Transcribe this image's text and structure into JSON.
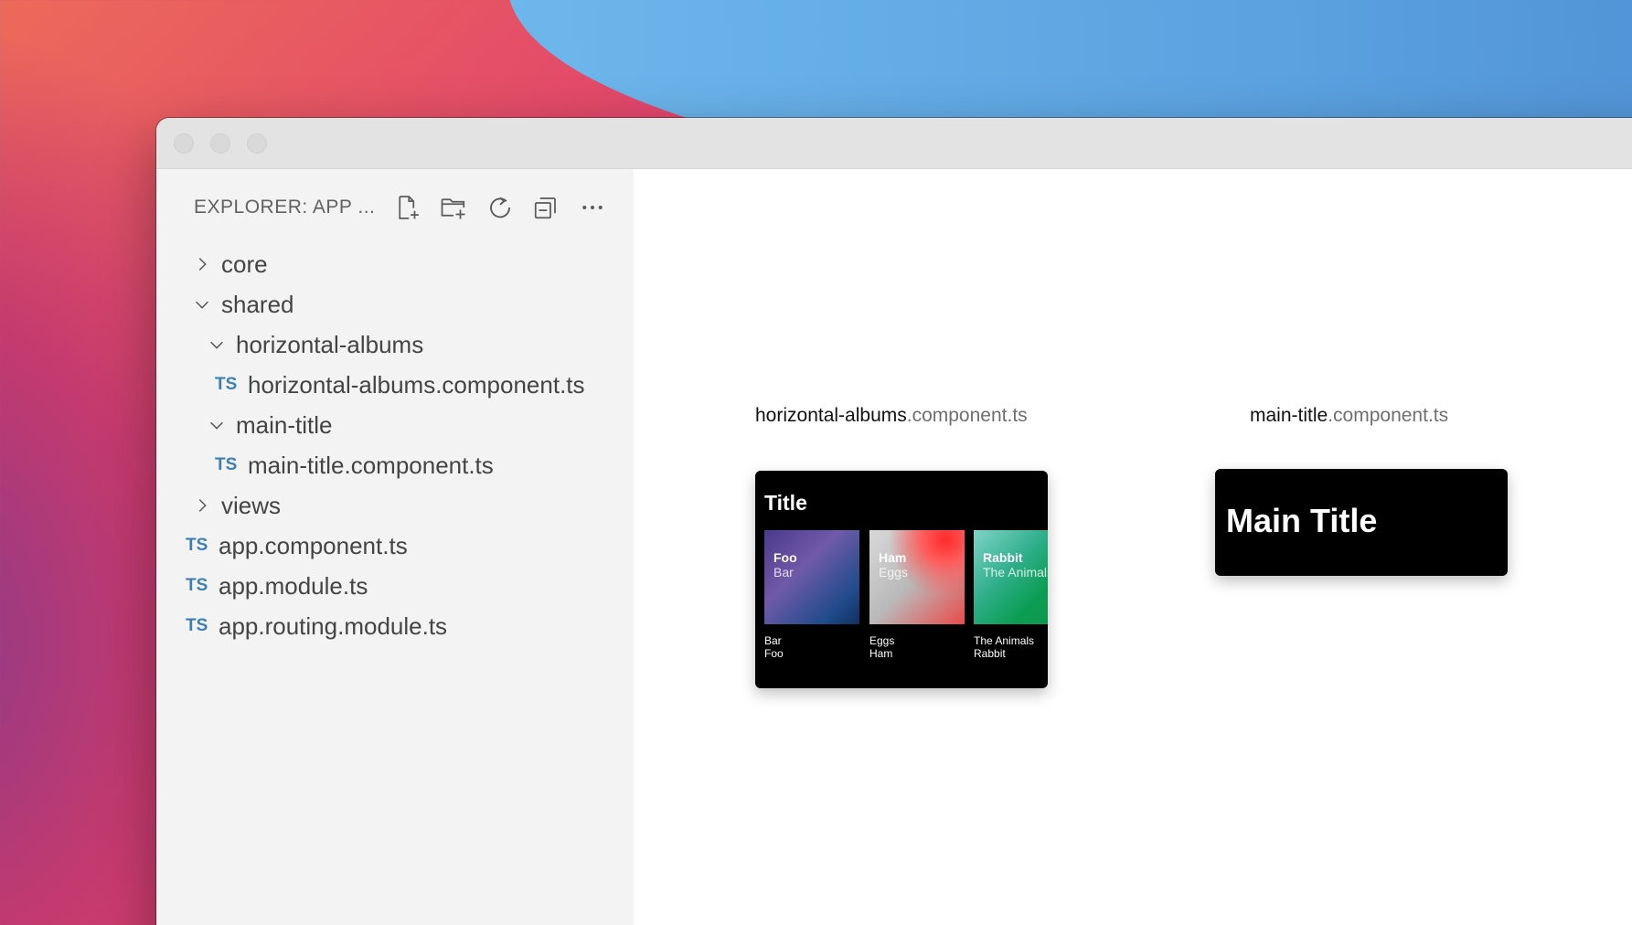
{
  "sidebar": {
    "title": "EXPLORER: APP ...",
    "toolbar": [
      "new-file-icon",
      "new-folder-icon",
      "refresh-icon",
      "collapse-all-icon",
      "more-icon"
    ],
    "tree": [
      {
        "label": "core",
        "kind": "folder",
        "expanded": false
      },
      {
        "label": "shared",
        "kind": "folder",
        "expanded": true
      },
      {
        "label": "horizontal-albums",
        "kind": "folder",
        "expanded": true
      },
      {
        "label": "horizontal-albums.component.ts",
        "kind": "ts-file",
        "badge": "TS"
      },
      {
        "label": "main-title",
        "kind": "folder",
        "expanded": true
      },
      {
        "label": "main-title.component.ts",
        "kind": "ts-file",
        "badge": "TS"
      },
      {
        "label": "views",
        "kind": "folder",
        "expanded": false
      },
      {
        "label": "app.component.ts",
        "kind": "ts-file",
        "badge": "TS"
      },
      {
        "label": "app.module.ts",
        "kind": "ts-file",
        "badge": "TS"
      },
      {
        "label": "app.routing.module.ts",
        "kind": "ts-file",
        "badge": "TS"
      }
    ]
  },
  "previews": {
    "albums": {
      "file_base": "horizontal-albums",
      "file_ext": ".component.ts",
      "card_title": "Title",
      "albums": [
        {
          "title": "Foo",
          "subtitle": "Bar",
          "caption1": "Bar",
          "caption2": "Foo"
        },
        {
          "title": "Ham",
          "subtitle": "Eggs",
          "caption1": "Eggs",
          "caption2": "Ham"
        },
        {
          "title": "Rabbit",
          "subtitle": "The Animals",
          "caption1": "The Animals",
          "caption2": "Rabbit"
        }
      ]
    },
    "main_title": {
      "file_base": "main-title",
      "file_ext": ".component.ts",
      "text": "Main Title"
    }
  },
  "colors": {
    "ts_badge": "#3d7fb3",
    "sidebar_bg": "#f3f3f3",
    "card_bg": "#000000"
  }
}
